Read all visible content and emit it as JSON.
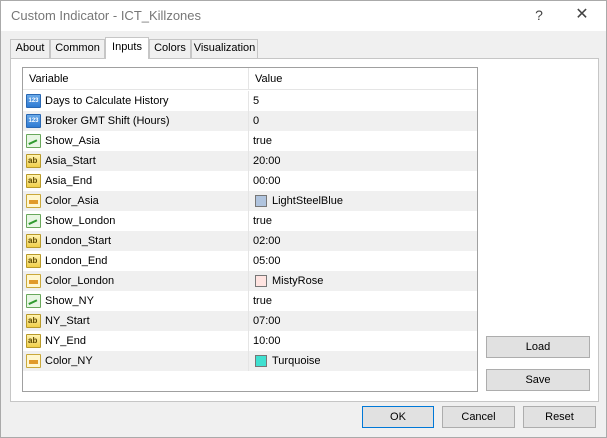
{
  "window": {
    "title": "Custom Indicator - ICT_Killzones",
    "help_glyph": "?",
    "close_glyph": "✕"
  },
  "tabs": [
    {
      "label": "About",
      "active": false
    },
    {
      "label": "Common",
      "active": false
    },
    {
      "label": "Inputs",
      "active": true
    },
    {
      "label": "Colors",
      "active": false
    },
    {
      "label": "Visualization",
      "active": false
    }
  ],
  "grid": {
    "headers": {
      "variable": "Variable",
      "value": "Value"
    },
    "rows": [
      {
        "type": "num",
        "variable": "Days to Calculate History",
        "value": "5"
      },
      {
        "type": "num",
        "variable": "Broker GMT Shift (Hours)",
        "value": "0"
      },
      {
        "type": "bool",
        "variable": "Show_Asia",
        "value": "true"
      },
      {
        "type": "str",
        "variable": "Asia_Start",
        "value": "20:00"
      },
      {
        "type": "str",
        "variable": "Asia_End",
        "value": "00:00"
      },
      {
        "type": "color",
        "variable": "Color_Asia",
        "value": "LightSteelBlue",
        "swatch": "#b0c4de"
      },
      {
        "type": "bool",
        "variable": "Show_London",
        "value": "true"
      },
      {
        "type": "str",
        "variable": "London_Start",
        "value": "02:00"
      },
      {
        "type": "str",
        "variable": "London_End",
        "value": "05:00"
      },
      {
        "type": "color",
        "variable": "Color_London",
        "value": "MistyRose",
        "swatch": "#ffe4e1"
      },
      {
        "type": "bool",
        "variable": "Show_NY",
        "value": "true"
      },
      {
        "type": "str",
        "variable": "NY_Start",
        "value": "07:00"
      },
      {
        "type": "str",
        "variable": "NY_End",
        "value": "10:00"
      },
      {
        "type": "color",
        "variable": "Color_NY",
        "value": "Turquoise",
        "swatch": "#40e0d0"
      }
    ]
  },
  "side_buttons": {
    "load": "Load",
    "save": "Save"
  },
  "footer": {
    "ok": "OK",
    "cancel": "Cancel",
    "reset": "Reset"
  },
  "colors": {
    "accent": "#0078d7",
    "alt_row": "#f0f0f0"
  }
}
